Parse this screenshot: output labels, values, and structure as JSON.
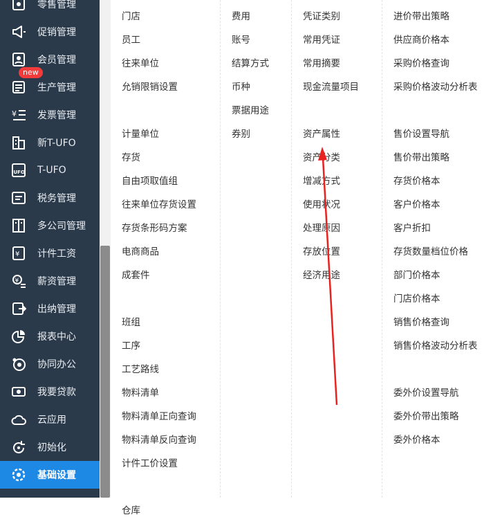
{
  "sidebar": {
    "items": [
      {
        "label": "零售管理",
        "icon": "retail-icon"
      },
      {
        "label": "促销管理",
        "icon": "megaphone-icon"
      },
      {
        "label": "会员管理",
        "icon": "member-icon"
      },
      {
        "label": "生产管理",
        "icon": "production-icon",
        "badge": "new"
      },
      {
        "label": "发票管理",
        "icon": "invoice-icon"
      },
      {
        "label": "新T-UFO",
        "icon": "building-icon"
      },
      {
        "label": "T-UFO",
        "icon": "ufo-icon"
      },
      {
        "label": "税务管理",
        "icon": "tax-icon"
      },
      {
        "label": "多公司管理",
        "icon": "multi-company-icon"
      },
      {
        "label": "计件工资",
        "icon": "piece-wage-icon"
      },
      {
        "label": "薪资管理",
        "icon": "salary-icon"
      },
      {
        "label": "出纳管理",
        "icon": "cashier-icon"
      },
      {
        "label": "报表中心",
        "icon": "pie-chart-icon"
      },
      {
        "label": "协同办公",
        "icon": "collaboration-icon"
      },
      {
        "label": "我要贷款",
        "icon": "loan-icon"
      },
      {
        "label": "云应用",
        "icon": "cloud-icon"
      },
      {
        "label": "初始化",
        "icon": "refresh-icon"
      },
      {
        "label": "基础设置",
        "icon": "settings-icon",
        "active": true
      }
    ]
  },
  "columns": [
    [
      "门店",
      "员工",
      "往来单位",
      "允销限销设置",
      "",
      "计量单位",
      "存货",
      "自由项取值组",
      "往来单位存货设置",
      "存货条形码方案",
      "电商商品",
      "成套件",
      "",
      "班组",
      "工序",
      "工艺路线",
      "物料清单",
      "物料清单正向查询",
      "物料清单反向查询",
      "计件工价设置",
      "",
      "仓库"
    ],
    [
      "费用",
      "账号",
      "结算方式",
      "币种",
      "票据用途",
      "券别"
    ],
    [
      "凭证类别",
      "常用凭证",
      "常用摘要",
      "现金流量项目",
      "",
      "资产属性",
      "资产分类",
      "增减方式",
      "使用状况",
      "处理原因",
      "存放位置",
      "经济用途"
    ],
    [
      "进价带出策略",
      "供应商价格本",
      "采购价格查询",
      "采购价格波动分析表",
      "",
      "售价设置导航",
      "售价带出策略",
      "存货价格本",
      "客户价格本",
      "客户折扣",
      "存货数量档位价格",
      "部门价格本",
      "门店价格本",
      "销售价格查询",
      "销售价格波动分析表",
      "",
      "委外价设置导航",
      "委外价带出策略",
      "委外价格本"
    ]
  ],
  "colors": {
    "sidebar_bg": "#2b3a4a",
    "active_bg": "#1e88e5",
    "badge": "#f23b3b",
    "arrow": "#e8231f"
  }
}
